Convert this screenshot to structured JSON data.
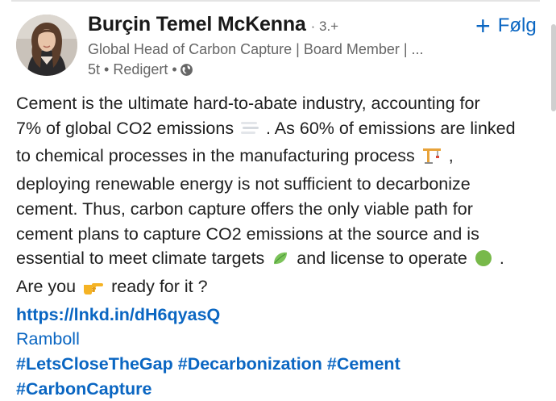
{
  "post": {
    "author": {
      "name": "Burçin Temel McKenna",
      "degree": "· 3.+",
      "headline": "Global Head of Carbon Capture | Board Member | ...",
      "time": "5t",
      "edited": "Redigert",
      "visibility_icon": "globe-icon"
    },
    "follow_label": "Følg",
    "body": {
      "l1": "Cement is the ultimate hard-to-abate industry, accounting for",
      "l2a": "7% of global CO2 emissions",
      "l2b": ". As 60% of emissions are linked",
      "l3a": "to chemical processes in the manufacturing process",
      "l3b": ",",
      "l4": "deploying renewable energy is not sufficient to decarbonize",
      "l5": "cement. Thus, carbon capture offers the only viable path for",
      "l6": "cement plans to capture CO2 emissions at the source and is",
      "l7a": "essential to meet climate targets",
      "l7b": "and license to operate",
      "l7c": ".",
      "l8a": "Are you",
      "l8b": "ready for it ?"
    },
    "link": "https://lnkd.in/dH6qyasQ",
    "mention": "Ramboll",
    "hashtags": [
      "#LetsCloseTheGap",
      "#Decarbonization",
      "#Cement",
      "#CarbonCapture"
    ],
    "emojis": [
      "fog-emoji",
      "crane-emoji",
      "leaf-emoji",
      "green-circle-emoji",
      "pointing-hand-emoji"
    ]
  }
}
